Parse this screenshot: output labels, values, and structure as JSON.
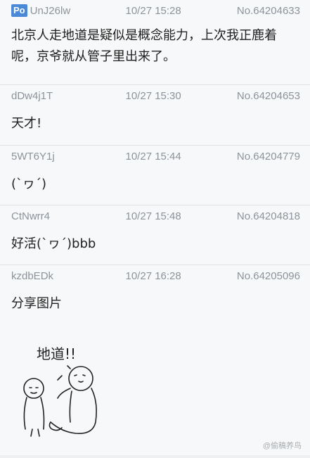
{
  "posts": [
    {
      "uid": "UnJ26lw",
      "po_badge": "Po",
      "time": "10/27 15:28",
      "no": "No.64204633",
      "text": "北京人走地道是疑似是概念能力，上次我正鹿着呢，京爷就从管子里出来了。"
    },
    {
      "uid": "dDw4j1T",
      "time": "10/27 15:30",
      "no": "No.64204653",
      "text": "天才!"
    },
    {
      "uid": "5WT6Y1j",
      "time": "10/27 15:44",
      "no": "No.64204779",
      "text": "(`ヮ´)"
    },
    {
      "uid": "CtNwrr4",
      "time": "10/27 15:48",
      "no": "No.64204818",
      "text": "好活(`ヮ´)bbb"
    },
    {
      "uid": "kzdbEDk",
      "time": "10/27 16:28",
      "no": "No.64205096",
      "text": "分享图片"
    }
  ],
  "drawing": {
    "caption": "地道!!"
  },
  "watermark": "@偷稿养鸟"
}
